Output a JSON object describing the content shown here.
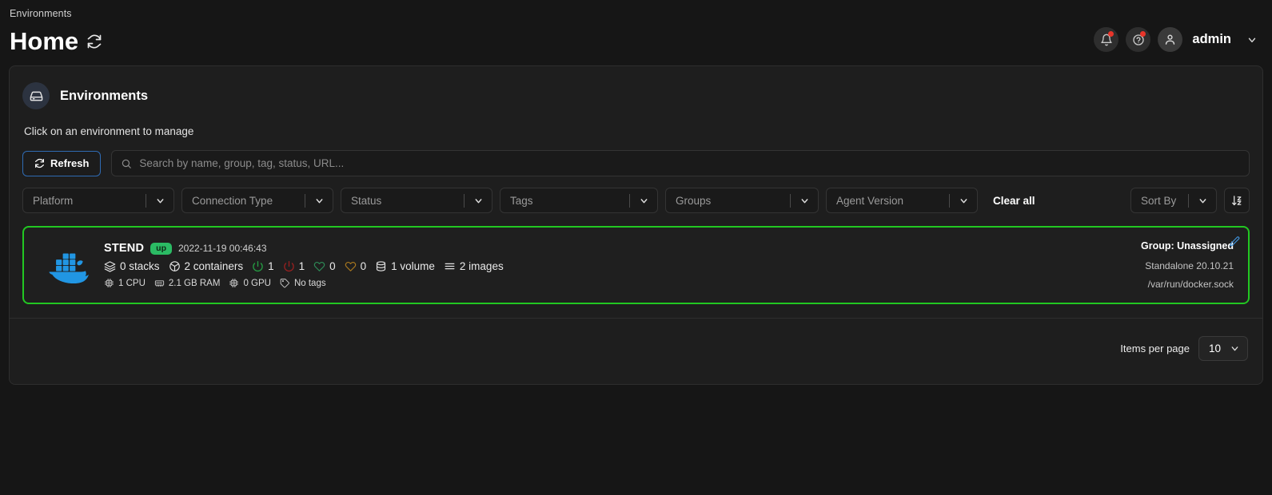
{
  "header": {
    "breadcrumb": "Environments",
    "title": "Home",
    "refresh_icon": "refresh-icon",
    "notifications_icon": "bell-icon",
    "help_icon": "help-circle-icon",
    "avatar_icon": "user-icon",
    "user": "admin",
    "caret_icon": "chevron-down-icon"
  },
  "panel": {
    "icon": "hard-drive-icon",
    "title": "Environments",
    "hint": "Click on an environment to manage"
  },
  "toolbar": {
    "refresh_label": "Refresh",
    "refresh_icon": "refresh-icon",
    "search_icon": "search-icon",
    "search_placeholder": "Search by name, group, tag, status, URL...",
    "search_value": ""
  },
  "filters": {
    "platform": "Platform",
    "connection_type": "Connection Type",
    "status": "Status",
    "tags": "Tags",
    "groups": "Groups",
    "agent_version": "Agent Version",
    "clear_all": "Clear all",
    "sort_by": "Sort By",
    "sort_direction_icon": "sort-descending-icon"
  },
  "environment": {
    "logo": "docker-whale-logo",
    "name": "STEND",
    "status_badge": "up",
    "timestamp": "2022-11-19 00:46:43",
    "stats": [
      {
        "icon": "layers-icon",
        "label": "0 stacks",
        "tone": "default"
      },
      {
        "icon": "box-icon",
        "label": "2 containers",
        "tone": "default"
      },
      {
        "icon": "power-icon",
        "label": "1",
        "tone": "green"
      },
      {
        "icon": "power-icon",
        "label": "1",
        "tone": "red"
      },
      {
        "icon": "heart-icon",
        "label": "0",
        "tone": "hgreen"
      },
      {
        "icon": "heart-icon",
        "label": "0",
        "tone": "horange"
      },
      {
        "icon": "database-icon",
        "label": "1 volume",
        "tone": "default"
      },
      {
        "icon": "list-icon",
        "label": "2 images",
        "tone": "default"
      }
    ],
    "resources": [
      {
        "icon": "cpu-icon",
        "label": "1 CPU"
      },
      {
        "icon": "memory-icon",
        "label": "2.1 GB RAM"
      },
      {
        "icon": "gpu-icon",
        "label": "0 GPU"
      },
      {
        "icon": "tag-icon",
        "label": "No tags"
      }
    ],
    "group": "Group: Unassigned",
    "engine": "Standalone 20.10.21",
    "url": "/var/run/docker.sock",
    "edit_icon": "pencil-icon",
    "border_color": "#22c722"
  },
  "footer": {
    "items_per_page_label": "Items per page",
    "items_per_page_value": "10",
    "chevron_icon": "chevron-down-icon"
  }
}
